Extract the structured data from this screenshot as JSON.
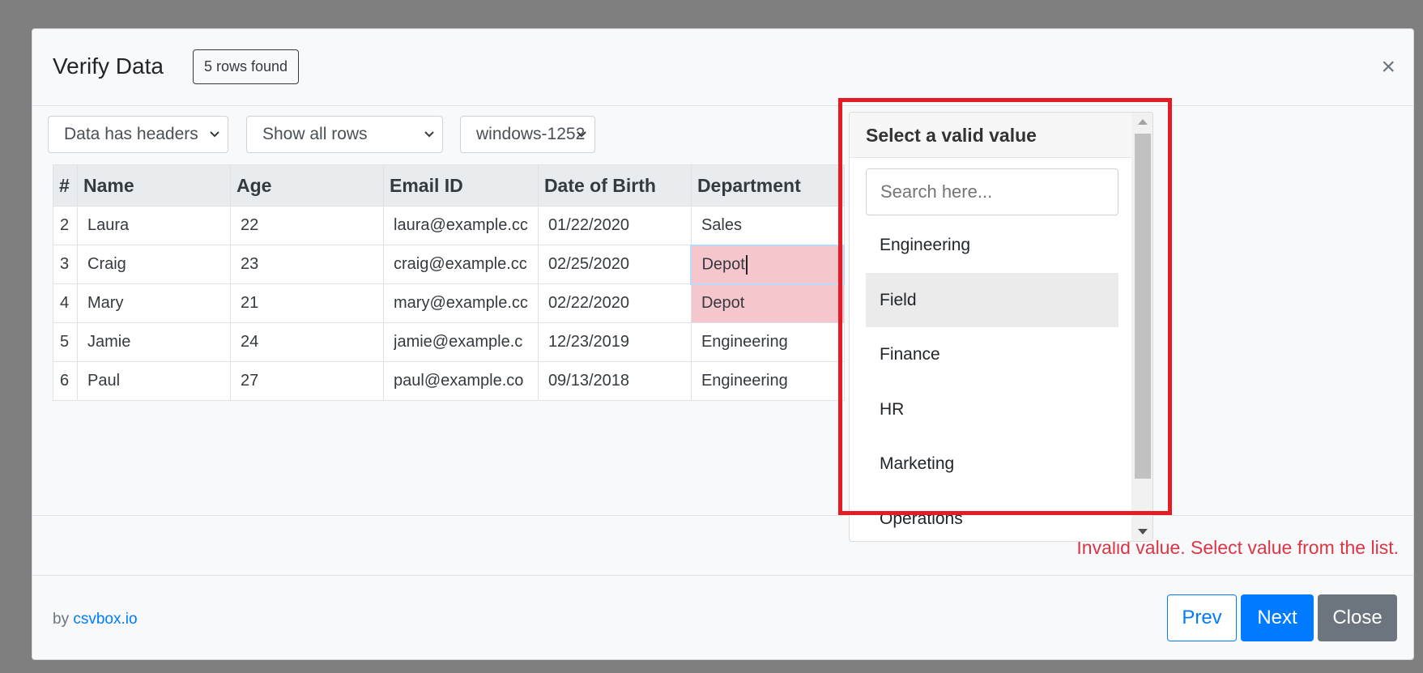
{
  "modal": {
    "title": "Verify Data",
    "rows_badge": "5 rows found",
    "close_symbol": "×"
  },
  "toolbar": {
    "headers_select": "Data has headers",
    "rows_select": "Show all rows",
    "encoding_select": "windows-1252"
  },
  "table": {
    "columns": [
      "#",
      "Name",
      "Age",
      "Email ID",
      "Date of Birth",
      "Department"
    ],
    "rows": [
      {
        "num": "2",
        "name": "Laura",
        "age": "22",
        "email": "laura@example.cc",
        "dob": "01/22/2020",
        "dept": "Sales"
      },
      {
        "num": "3",
        "name": "Craig",
        "age": "23",
        "email": "craig@example.cc",
        "dob": "02/25/2020",
        "dept": "Depot"
      },
      {
        "num": "4",
        "name": "Mary",
        "age": "21",
        "email": "mary@example.cc",
        "dob": "02/22/2020",
        "dept": "Depot"
      },
      {
        "num": "5",
        "name": "Jamie",
        "age": "24",
        "email": "jamie@example.c",
        "dob": "12/23/2019",
        "dept": "Engineering"
      },
      {
        "num": "6",
        "name": "Paul",
        "age": "27",
        "email": "paul@example.co",
        "dob": "09/13/2018",
        "dept": "Engineering"
      }
    ]
  },
  "dropdown": {
    "header": "Select a valid value",
    "search_placeholder": "Search here...",
    "options": [
      "Engineering",
      "Field",
      "Finance",
      "HR",
      "Marketing",
      "Operations"
    ],
    "selected": "Field"
  },
  "error_message": "Invalid value. Select value from the list.",
  "footer": {
    "by_prefix": "by",
    "brand_link": "csvbox.io",
    "prev_label": "Prev",
    "next_label": "Next",
    "close_label": "Close"
  },
  "colors": {
    "primary": "#007bff",
    "invalid_cell": "#f5c6cb",
    "error_text": "#dc3545",
    "highlight_border": "#e51c23",
    "secondary": "#6c757d"
  }
}
